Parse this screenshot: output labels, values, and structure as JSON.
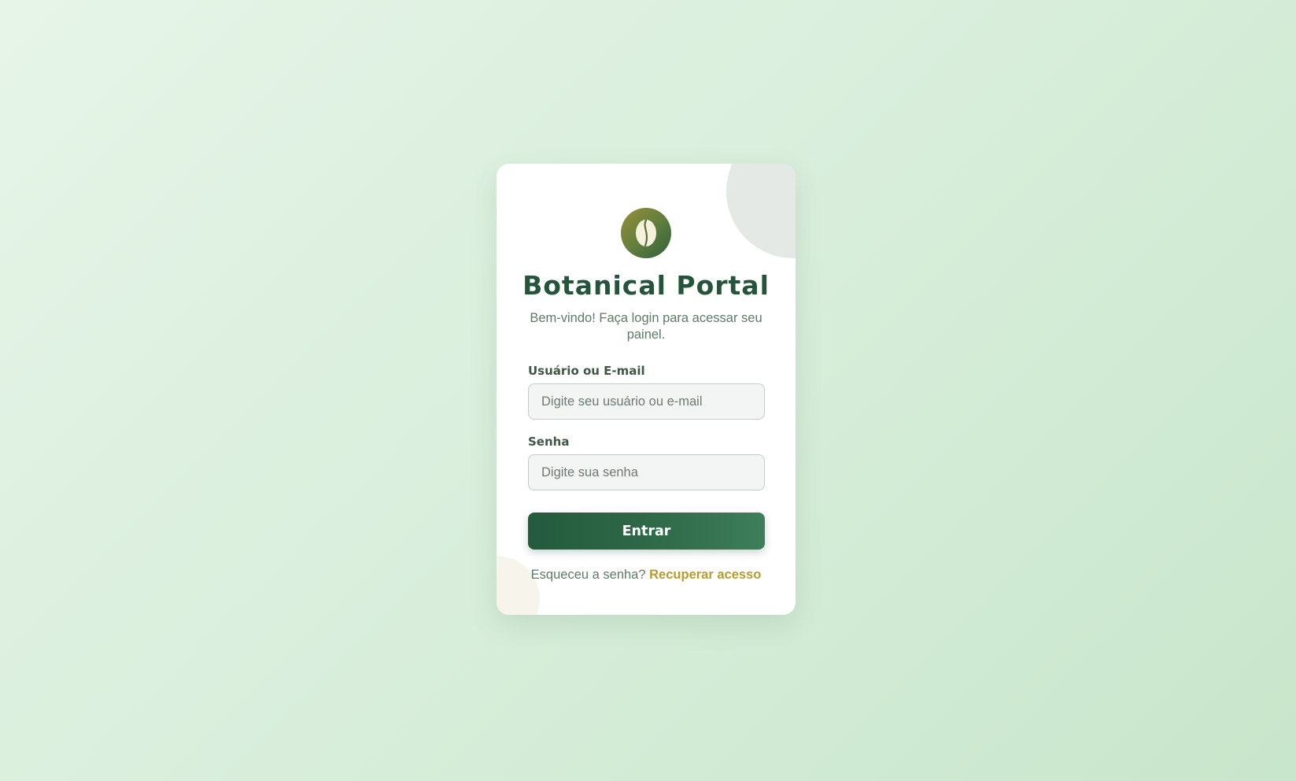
{
  "app": {
    "title": "Botanical Portal",
    "subtitle": "Bem-vindo! Faça login para acessar seu painel.",
    "logo_icon": "coffee-bean-icon"
  },
  "form": {
    "user_label": "Usuário ou E-mail",
    "user_placeholder": "Digite seu usuário ou e-mail",
    "user_value": "",
    "password_label": "Senha",
    "password_placeholder": "Digite sua senha",
    "password_value": "",
    "submit_label": "Entrar"
  },
  "footer": {
    "forgot_text": "Esqueceu a senha?",
    "recover_link": "Recuperar acesso"
  },
  "colors": {
    "primary": "#24543a",
    "accent": "#b79a32",
    "background": "#d8eedb"
  }
}
